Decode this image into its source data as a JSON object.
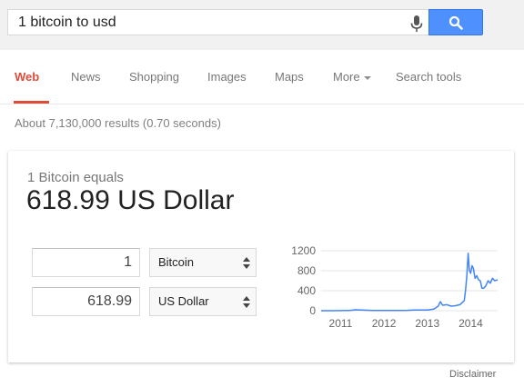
{
  "search": {
    "query": "1 bitcoin to usd",
    "mic_icon": "microphone-icon",
    "search_icon": "magnifier-icon",
    "button_color": "#4d90fe"
  },
  "tabs": [
    {
      "label": "Web",
      "active": true
    },
    {
      "label": "News"
    },
    {
      "label": "Shopping"
    },
    {
      "label": "Images"
    },
    {
      "label": "Maps"
    },
    {
      "label": "More"
    },
    {
      "label": "Search tools"
    }
  ],
  "accent_color": "#dd4b39",
  "results_stats": "About 7,130,000 results (0.70 seconds)",
  "converter": {
    "equals_label": "1 Bitcoin equals",
    "result_text": "618.99 US Dollar",
    "from_amount": "1",
    "from_currency": "Bitcoin",
    "to_amount": "618.99",
    "to_currency": "US Dollar"
  },
  "chart_data": {
    "type": "line",
    "title": "",
    "xlabel": "",
    "ylabel": "",
    "x_ticks": [
      "2011",
      "2012",
      "2013",
      "2014"
    ],
    "y_ticks": [
      "1200",
      "800",
      "400",
      "0"
    ],
    "ylim": [
      0,
      1200
    ],
    "xlim": [
      2010.55,
      2014.62
    ],
    "grid": true,
    "line_color": "#4285f4",
    "series": [
      {
        "x": [
          2010.55,
          2010.8,
          2011.0,
          2011.2,
          2011.35,
          2011.45,
          2011.5,
          2011.6,
          2011.75,
          2011.9,
          2012.0,
          2012.2,
          2012.4,
          2012.55,
          2012.7,
          2012.9,
          2013.0,
          2013.15,
          2013.25,
          2013.3,
          2013.35,
          2013.45,
          2013.55,
          2013.65,
          2013.75,
          2013.85,
          2013.88,
          2013.91,
          2013.94,
          2013.97,
          2014.0,
          2014.03,
          2014.06,
          2014.1,
          2014.14,
          2014.18,
          2014.22,
          2014.26,
          2014.3,
          2014.35,
          2014.4,
          2014.45,
          2014.5,
          2014.55,
          2014.62
        ],
        "y": [
          0,
          0,
          1,
          5,
          18,
          14,
          12,
          10,
          5,
          3,
          5,
          5,
          6,
          8,
          12,
          12,
          13,
          30,
          90,
          180,
          110,
          120,
          90,
          100,
          120,
          200,
          400,
          700,
          1150,
          800,
          750,
          900,
          850,
          650,
          700,
          620,
          600,
          450,
          450,
          500,
          600,
          550,
          650,
          600,
          619
        ]
      }
    ]
  },
  "disclaimer": "Disclaimer"
}
